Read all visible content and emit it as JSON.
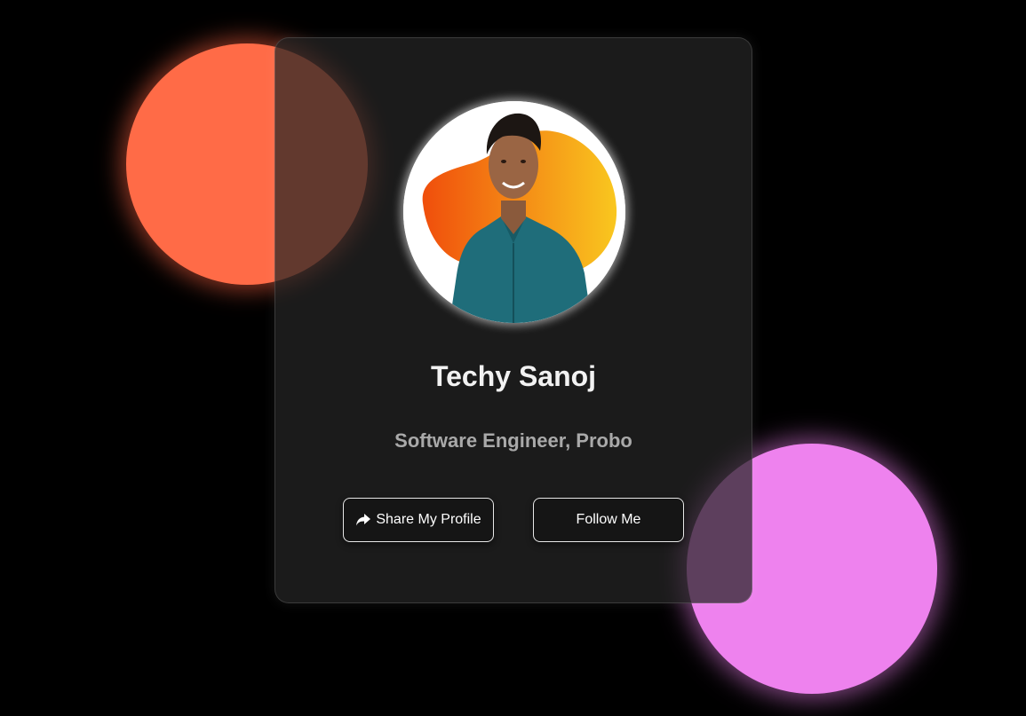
{
  "profile": {
    "name": "Techy Sanoj",
    "role": "Software Engineer, Probo"
  },
  "actions": {
    "share_label": "Share My Profile",
    "share_icon": "share-icon",
    "follow_label": "Follow Me"
  },
  "colors": {
    "background": "#000000",
    "card": "#1a1a1a",
    "orb_orange": "#ff6b47",
    "orb_pink": "#ee82ee",
    "blob_start": "#f04e0c",
    "blob_end": "#f9c71f",
    "shirt": "#1f6d7a"
  }
}
